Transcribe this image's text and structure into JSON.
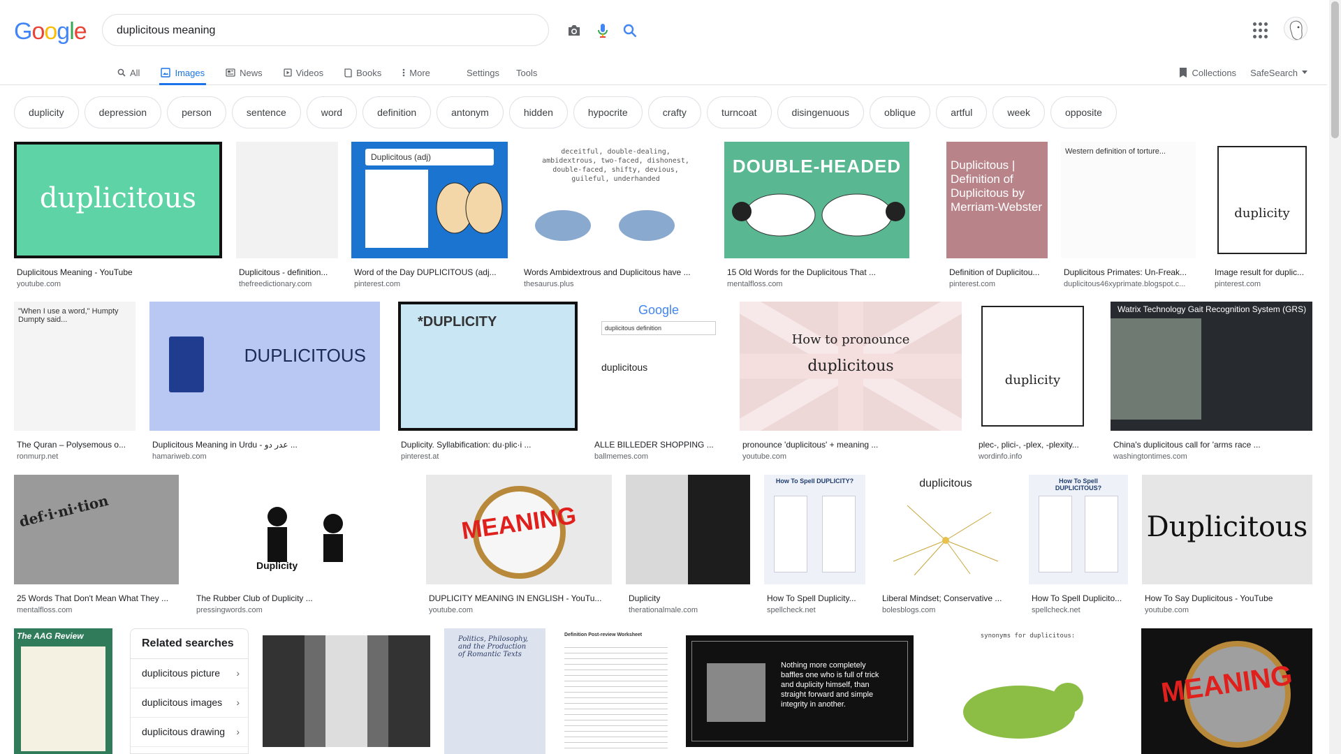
{
  "logo": {
    "letters": [
      "G",
      "o",
      "o",
      "g",
      "l",
      "e"
    ],
    "colors": [
      "#4285f4",
      "#ea4335",
      "#fbbc05",
      "#4285f4",
      "#34a853",
      "#ea4335"
    ]
  },
  "search": {
    "query": "duplicitous meaning"
  },
  "tabs": [
    {
      "label": "All",
      "icon": "search-icon"
    },
    {
      "label": "Images",
      "icon": "image-icon",
      "active": true
    },
    {
      "label": "News",
      "icon": "news-icon"
    },
    {
      "label": "Videos",
      "icon": "video-icon"
    },
    {
      "label": "Books",
      "icon": "book-icon"
    },
    {
      "label": "More",
      "icon": "more-vert-icon"
    }
  ],
  "settings_label": "Settings",
  "tools_label": "Tools",
  "collections_label": "Collections",
  "safesearch_label": "SafeSearch",
  "chips": [
    "duplicity",
    "depression",
    "person",
    "sentence",
    "word",
    "definition",
    "antonym",
    "hidden",
    "hypocrite",
    "crafty",
    "turncoat",
    "disingenuous",
    "oblique",
    "artful",
    "week",
    "opposite"
  ],
  "results": [
    {
      "caption": "Duplicitous Meaning - YouTube",
      "source": "youtube.com",
      "thumb_text": "duplicitous",
      "bg": "#5dd3a6",
      "fg": "#ffffff"
    },
    {
      "caption": "Duplicitous - definition...",
      "source": "thefreedictionary.com",
      "thumb_text": "",
      "bg": "#f2f2f2",
      "fg": "#333333"
    },
    {
      "caption": "Word of the Day DUPLICITOUS (adj...",
      "source": "pinterest.com",
      "thumb_text": "Duplicitous (adj)",
      "bg": "#1b75d0",
      "fg": "#ffffff"
    },
    {
      "caption": "Words Ambidextrous and Duplicitous have ...",
      "source": "thesaurus.plus",
      "thumb_text": "deceitful, double-dealing, ambidextrous, two-faced, dishonest, double-faced, shifty, devious, guileful, underhanded",
      "bg": "#ffffff",
      "fg": "#555555"
    },
    {
      "caption": "15 Old Words for the Duplicitous That ...",
      "source": "mentalfloss.com",
      "thumb_text": "DOUBLE-HEADED",
      "bg": "#59b892",
      "fg": "#ffffff"
    },
    {
      "caption": "Definition of Duplicitou...",
      "source": "pinterest.com",
      "thumb_text": "Duplicitous | Definition of Duplicitous by Merriam-Webster",
      "bg": "#b8848a",
      "fg": "#ffffff"
    },
    {
      "caption": "Duplicitous Primates: Un-Freak...",
      "source": "duplicitous46xyprimate.blogspot.c...",
      "thumb_text": "Western definition of torture...",
      "bg": "#fbfbfb",
      "fg": "#333333"
    },
    {
      "caption": "Image result for duplic...",
      "source": "pinterest.com",
      "thumb_text": "duplicity",
      "bg": "#ffffff",
      "fg": "#222222"
    },
    {
      "caption": "The Quran – Polysemous o...",
      "source": "ronmurp.net",
      "thumb_text": "\"When I use a word,\" Humpty Dumpty said...",
      "bg": "#f4f4f4",
      "fg": "#333333"
    },
    {
      "caption": "Duplicitous Meaning in Urdu - عدر دو ...",
      "source": "hamariweb.com",
      "thumb_text": "DUPLICITOUS",
      "bg": "#b9c8f3",
      "fg": "#1c2a55"
    },
    {
      "caption": "Duplicity. Syllabification: du·plic·i ...",
      "source": "pinterest.at",
      "thumb_text": "*DUPLICITY",
      "bg": "#c9e6f5",
      "fg": "#333333"
    },
    {
      "caption": "ALLE BILLEDER SHOPPING ...",
      "source": "ballmemes.com",
      "thumb_text": "duplicitous definition",
      "bg": "#ffffff",
      "fg": "#333333"
    },
    {
      "caption": "pronounce 'duplicitous' + meaning ...",
      "source": "youtube.com",
      "thumb_text": "How to pronounce",
      "bg": "#eed7d7",
      "fg": "#222222"
    },
    {
      "caption": "plec-, plici-, -plex, -plexity...",
      "source": "wordinfo.info",
      "thumb_text": "duplicity",
      "bg": "#ffffff",
      "fg": "#222222"
    },
    {
      "caption": "China's duplicitous call for 'arms race ...",
      "source": "washingtontimes.com",
      "thumb_text": "Watrix Technology Gait Recognition System (GRS)",
      "bg": "#272a2e",
      "fg": "#ffffff"
    },
    {
      "caption": "25 Words That Don't Mean What They ...",
      "source": "mentalfloss.com",
      "thumb_text": "def·i·ni·tion",
      "bg": "#9a9a9a",
      "fg": "#222222"
    },
    {
      "caption": "The Rubber Club of Duplicity ...",
      "source": "pressingwords.com",
      "thumb_text": "Duplicity",
      "bg": "#ffffff",
      "fg": "#111111"
    },
    {
      "caption": "DUPLICITY MEANING IN ENGLISH - YouTu...",
      "source": "youtube.com",
      "thumb_text": "MEANING",
      "bg": "#e9e9e9",
      "fg": "#e0201c"
    },
    {
      "caption": "Duplicity",
      "source": "therationalmale.com",
      "thumb_text": "",
      "bg": "#5a5a5a",
      "fg": "#ffffff"
    },
    {
      "caption": "How To Spell Duplicity...",
      "source": "spellcheck.net",
      "thumb_text": "How To Spell DUPLICITY?",
      "bg": "#eef2f8",
      "fg": "#1f3c6e"
    },
    {
      "caption": "Liberal Mindset; Conservative ...",
      "source": "bolesblogs.com",
      "thumb_text": "duplicitous",
      "bg": "#ffffff",
      "fg": "#222222"
    },
    {
      "caption": "How To Spell Duplicito...",
      "source": "spellcheck.net",
      "thumb_text": "How To Spell DUPLICITOUS?",
      "bg": "#eef2f8",
      "fg": "#1f3c6e"
    },
    {
      "caption": "How To Say Duplicitous - YouTube",
      "source": "youtube.com",
      "thumb_text": "Duplicitous",
      "bg": "#e6e6e6",
      "fg": "#111111"
    },
    {
      "caption": "",
      "source": "",
      "thumb_text": "The AAG Review",
      "bg": "#2f7b5a",
      "fg": "#ffffff"
    },
    {
      "caption": "",
      "source": "",
      "thumb_text": "",
      "bg": "#6b6b6b",
      "fg": "#ffffff"
    },
    {
      "caption": "",
      "source": "",
      "thumb_text": "Politics, Philosophy, and the Production of Romantic Texts",
      "bg": "#dde3ee",
      "fg": "#2a3b66"
    },
    {
      "caption": "",
      "source": "",
      "thumb_text": "Definition Post-review Worksheet",
      "bg": "#ffffff",
      "fg": "#333333"
    },
    {
      "caption": "",
      "source": "",
      "thumb_text": "Nothing more completely baffles one who is full of trick and duplicity himself, than straight forward and simple integrity in another.",
      "bg": "#111111",
      "fg": "#ffffff"
    },
    {
      "caption": "",
      "source": "",
      "thumb_text": "synonyms for duplicitous:",
      "bg": "#ffffff",
      "fg": "#444444"
    },
    {
      "caption": "",
      "source": "",
      "thumb_text": "MEANING",
      "bg": "#111111",
      "fg": "#e0201c"
    }
  ],
  "related": {
    "title": "Related searches",
    "items": [
      "duplicitous picture",
      "duplicitous images",
      "duplicitous drawing"
    ]
  }
}
